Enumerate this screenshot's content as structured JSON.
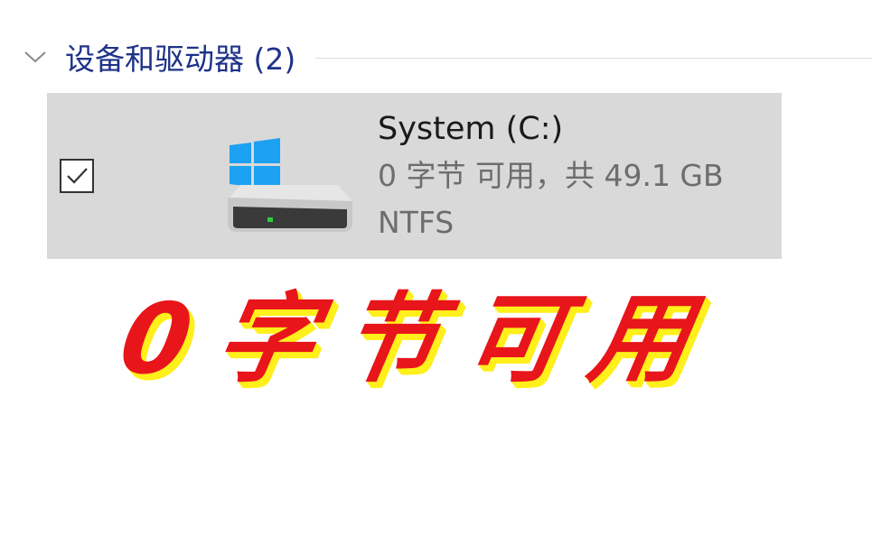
{
  "group": {
    "title": "设备和驱动器 (2)",
    "chevron_icon": "chevron-down-icon"
  },
  "drive": {
    "name": "System (C:)",
    "space": "0 字节 可用，共 49.1 GB",
    "filesystem": "NTFS",
    "checked": true,
    "icon": "windows-system-drive-icon",
    "colors": {
      "tile_selected": "#d9d9d9",
      "windows_logo": "#1da1f2",
      "drive_light": "#2ecc40"
    }
  },
  "caption": {
    "text": "0字节可用",
    "color": "#e8151b",
    "shadow_color": "#ffef1a"
  }
}
